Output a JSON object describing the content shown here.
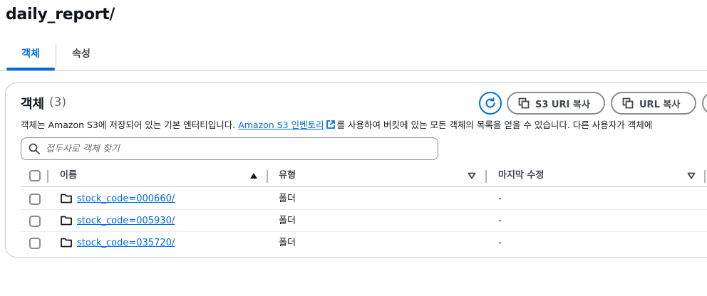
{
  "page": {
    "title": "daily_report/"
  },
  "tabs": [
    {
      "label": "객체",
      "active": true
    },
    {
      "label": "속성",
      "active": false
    }
  ],
  "objects_panel": {
    "title": "객체",
    "count": "(3)",
    "description_before": "객체는 Amazon S3에 저장되어 있는 기본 엔터티입니다. ",
    "description_link": "Amazon S3 인벤토리",
    "description_after": "를 사용하여 버킷에 있는 모든 객체의 목록을 얻을 수 있습니다. 다른 사용자가 객체에",
    "actions": {
      "copy_s3_uri": "S3 URI 복사",
      "copy_url": "URL 복사"
    },
    "search": {
      "placeholder": "접두사로 객체 찾기",
      "value": ""
    }
  },
  "table": {
    "columns": [
      "이름",
      "유형",
      "마지막 수정"
    ],
    "sorted_column": "이름",
    "rows": [
      {
        "name": "stock_code=000660/",
        "type": "폴더",
        "last_modified": "-"
      },
      {
        "name": "stock_code=005930/",
        "type": "폴더",
        "last_modified": "-"
      },
      {
        "name": "stock_code=035720/",
        "type": "폴더",
        "last_modified": "-"
      }
    ]
  },
  "colors": {
    "accent": "#006ce0",
    "border": "#c6c6cd",
    "text": "#16191f",
    "muted": "#656871"
  },
  "icons": [
    "refresh-icon",
    "copy-icon",
    "external-link-icon",
    "search-icon",
    "sort-up-icon",
    "sort-down-icon",
    "folder-icon"
  ]
}
